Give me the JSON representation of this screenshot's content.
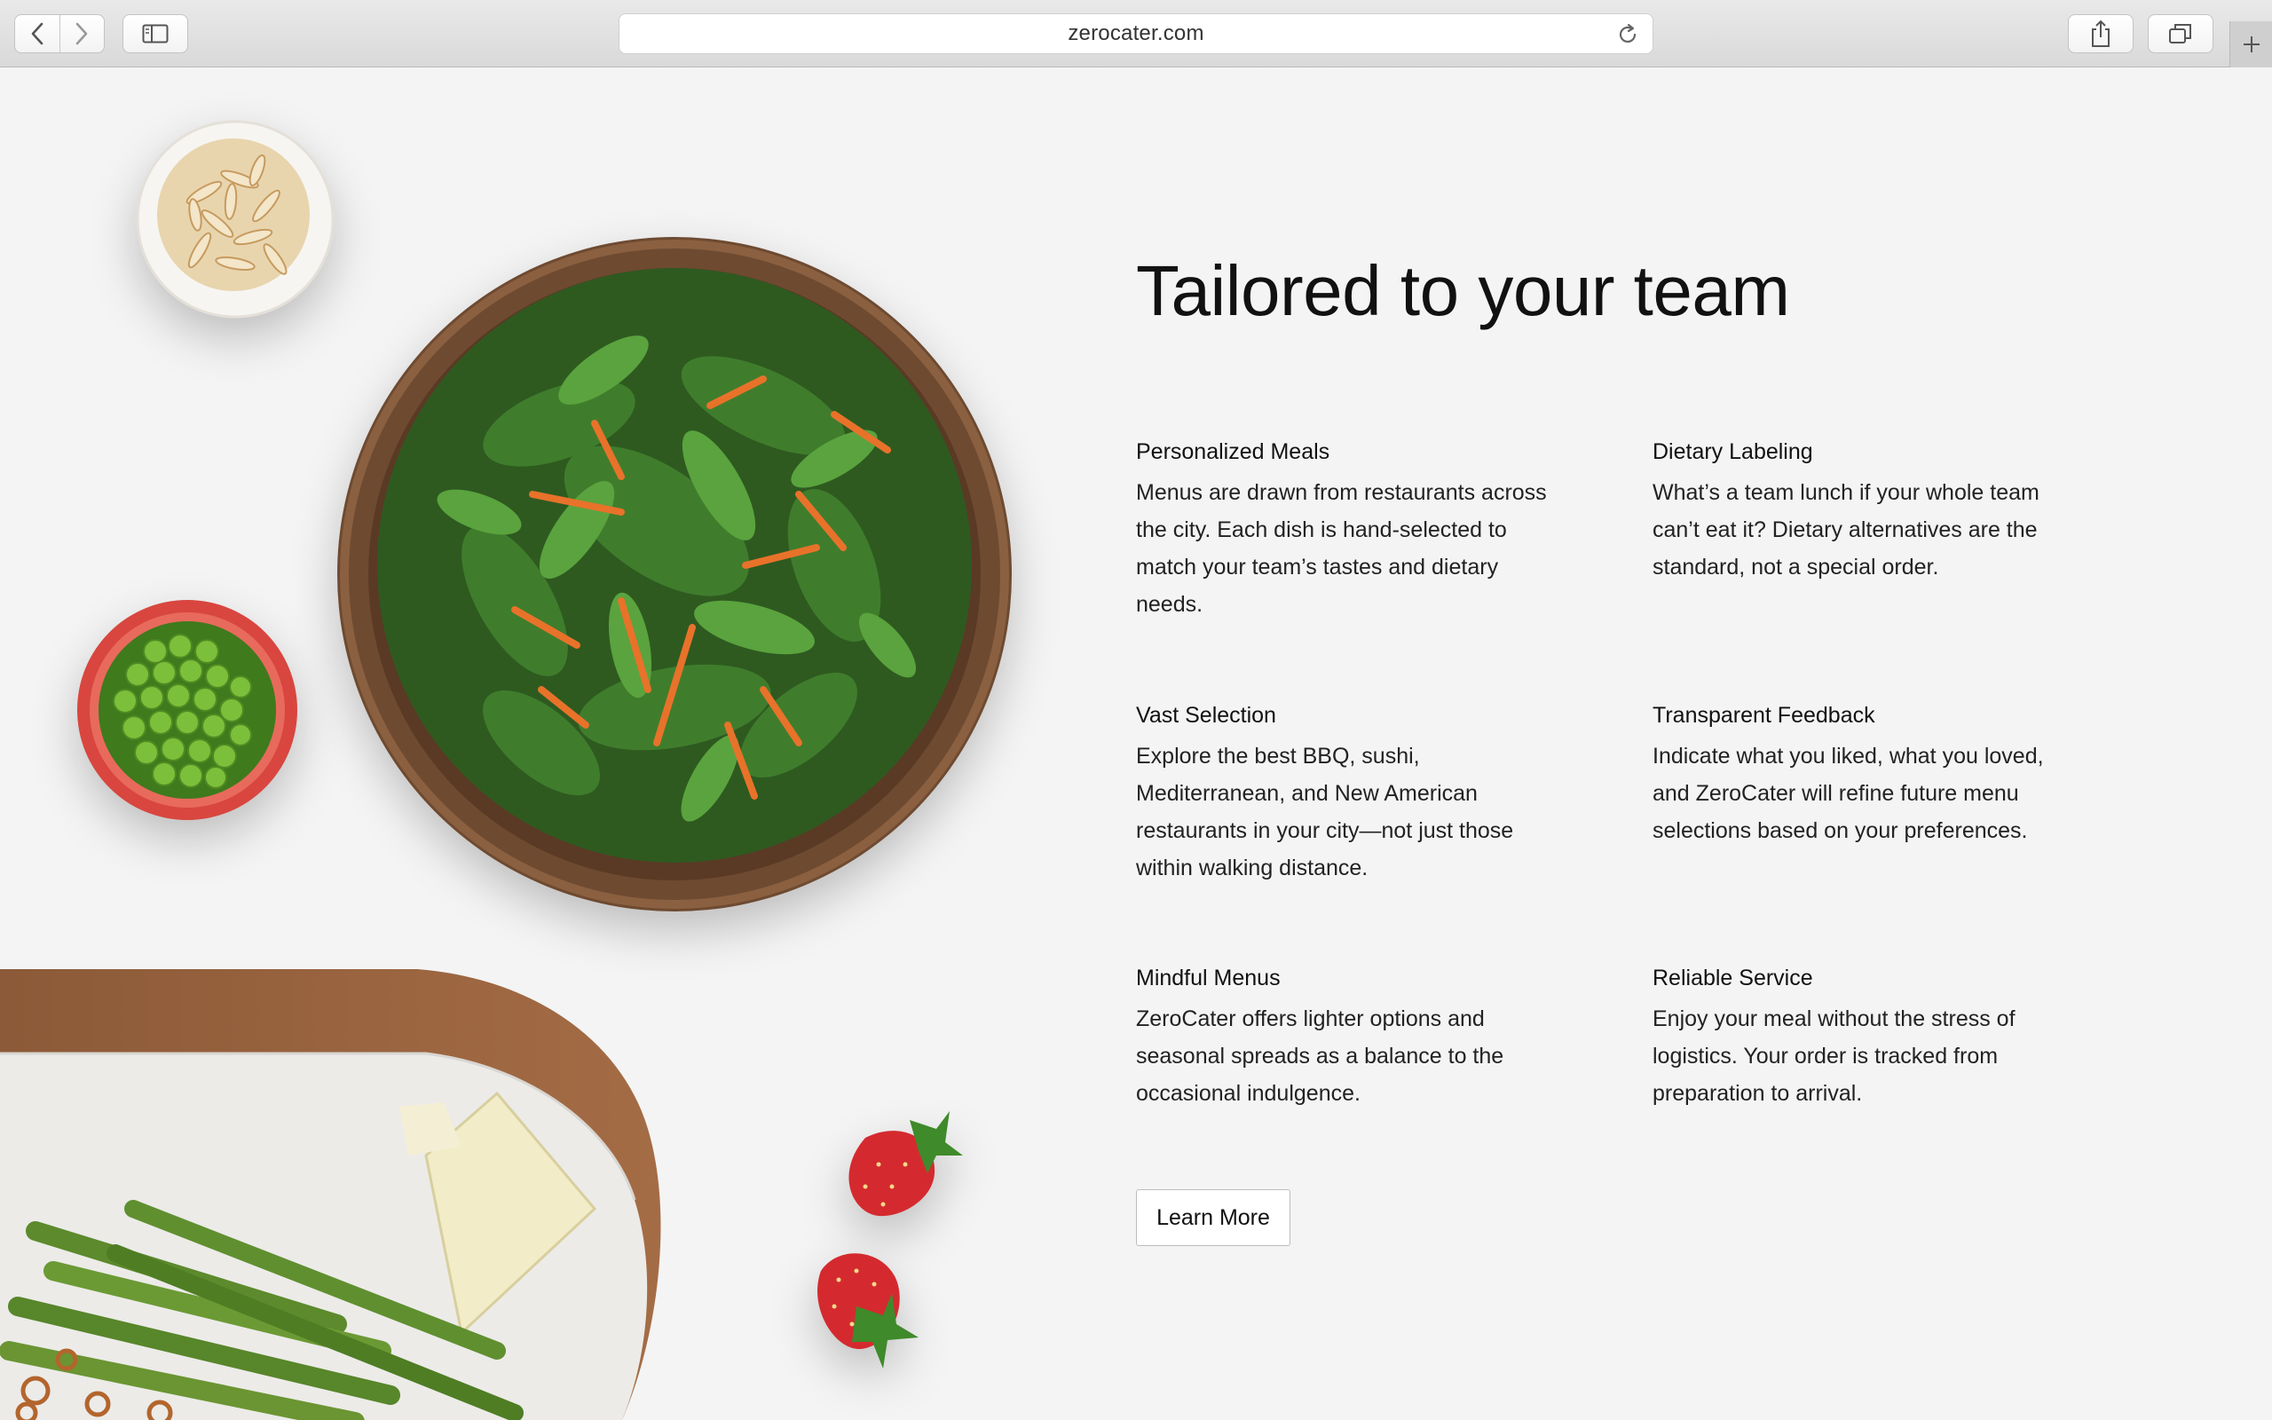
{
  "browser": {
    "url": "zerocater.com"
  },
  "icons": {
    "back": "chevron-left-icon",
    "forward": "chevron-right-icon",
    "sidebar": "sidebar-icon",
    "reload": "reload-icon",
    "share": "share-icon",
    "tabs": "tabs-overview-icon",
    "new_tab": "plus-icon"
  },
  "content": {
    "title": "Tailored to your team",
    "features": [
      {
        "heading": "Personalized Meals",
        "body": "Menus are drawn from restaurants across the city. Each dish is hand-selected to match your team’s tastes and dietary needs."
      },
      {
        "heading": "Dietary Labeling",
        "body": "What’s a team lunch if your whole team can’t eat it? Dietary alternatives are the standard, not a special order."
      },
      {
        "heading": "Vast Selection",
        "body": "Explore the best BBQ, sushi, Mediterranean, and New American restaurants in your city—not just those within walking distance."
      },
      {
        "heading": "Transparent Feedback",
        "body": "Indicate what you liked, what you loved, and ZeroCater will refine future menu selections based on your preferences."
      },
      {
        "heading": "Mindful Menus",
        "body": "ZeroCater offers lighter options and seasonal spreads as a balance to the occasional indulgence."
      },
      {
        "heading": "Reliable Service",
        "body": "Enjoy your meal without the stress of logistics. Your order is tracked from preparation to arrival."
      }
    ],
    "cta_label": "Learn More"
  },
  "colors": {
    "page_background": "#f4f4f4",
    "text": "#111111"
  }
}
